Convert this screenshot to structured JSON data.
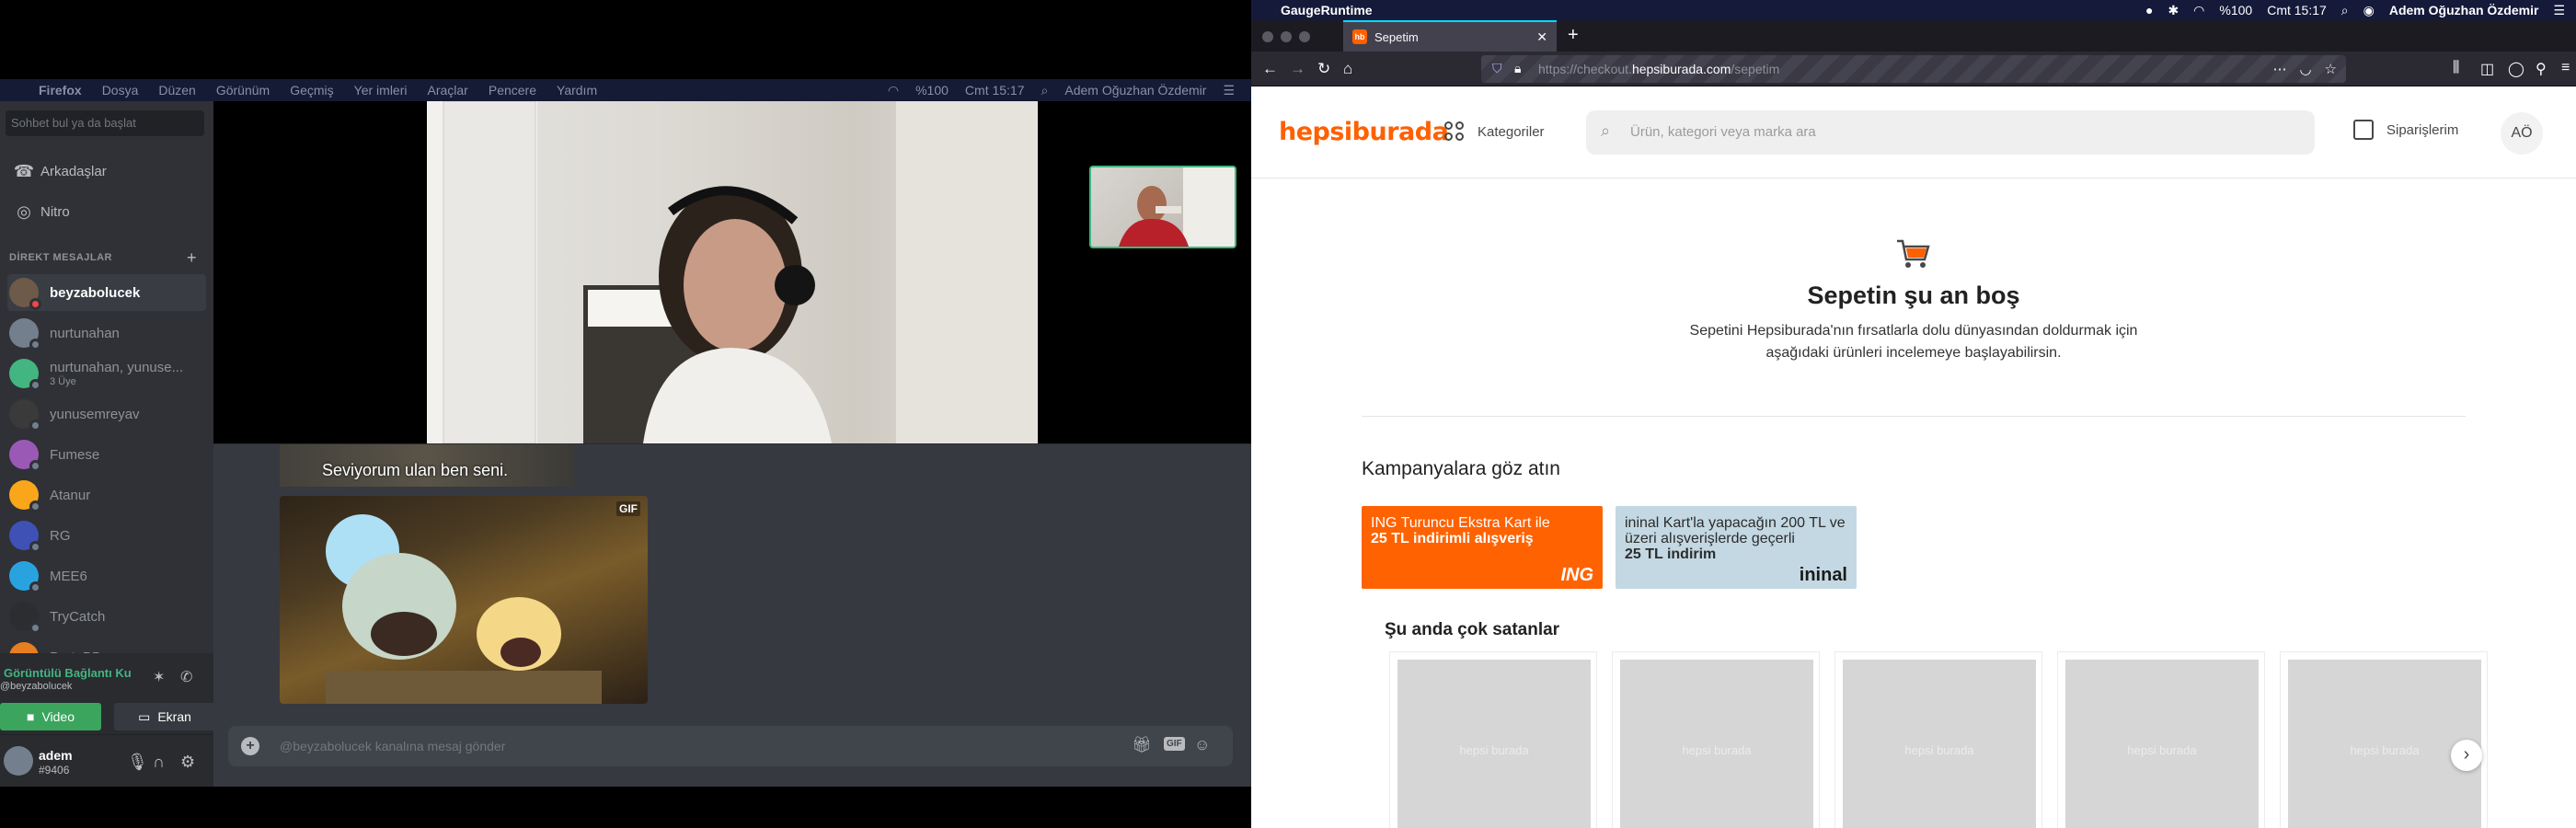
{
  "left": {
    "menubar": {
      "app": "Firefox",
      "items": [
        "Dosya",
        "Düzen",
        "Görünüm",
        "Geçmiş",
        "Yer imleri",
        "Araçlar",
        "Pencere",
        "Yardım"
      ],
      "battery": "%100",
      "clock": "Cmt 15:17",
      "user": "Adem Oğuzhan Özdemir"
    },
    "sidebar": {
      "search_placeholder": "Sohbet bul ya da başlat",
      "nav": [
        {
          "label": "Arkadaşlar",
          "icon": "friends-icon"
        },
        {
          "label": "Nitro",
          "icon": "nitro-icon"
        }
      ],
      "dm_header": "DİREKT MESAJLAR",
      "dms": [
        {
          "name": "beyzabolucek",
          "sub": "",
          "color": "#6d5a48",
          "selected": true
        },
        {
          "name": "nurtunahan",
          "sub": "",
          "color": "#747f8d",
          "selected": false
        },
        {
          "name": "nurtunahan, yunuse...",
          "sub": "3 Üye",
          "color": "#43b581",
          "selected": false
        },
        {
          "name": "yunusemreyav",
          "sub": "",
          "color": "#3a3a3a",
          "selected": false
        },
        {
          "name": "Fumese",
          "sub": "",
          "color": "#9b59b6",
          "selected": false
        },
        {
          "name": "Atanur",
          "sub": "",
          "color": "#faa61a",
          "selected": false
        },
        {
          "name": "RG",
          "sub": "",
          "color": "#3f51b5",
          "selected": false
        },
        {
          "name": "MEE6",
          "sub": "",
          "color": "#29a3e0",
          "selected": false
        },
        {
          "name": "TryCatch",
          "sub": "",
          "color": "#2b2d31",
          "selected": false
        },
        {
          "name": "PrataBB",
          "sub": "",
          "color": "#e67e22",
          "selected": false
        }
      ],
      "voice_status": "Görüntülü Bağlantı Ku",
      "voice_channel": "@beyzabolucek",
      "video_label": "Video",
      "screen_label": "Ekran",
      "user_name": "adem",
      "user_tag": "#9406"
    },
    "chat": {
      "caption": "Seviyorum ulan ben seni.",
      "gif_tag": "GIF",
      "input_placeholder": "@beyzabolucek kanalına mesaj gönder",
      "gif_button": "GIF"
    }
  },
  "right": {
    "menubar": {
      "app": "GaugeRuntime",
      "battery": "%100",
      "clock": "Cmt 15:17",
      "user": "Adem Oğuzhan Özdemir"
    },
    "tab": {
      "favicon": "hb",
      "title": "Sepetim"
    },
    "url": {
      "prefix": "https://checkout.",
      "domain": "hepsiburada.com",
      "suffix": "/sepetim"
    },
    "site": {
      "logo": "hepsiburada",
      "categories": "Kategoriler",
      "search_placeholder": "Ürün, kategori veya marka ara",
      "orders": "Siparişlerim",
      "avatar": "AÖ",
      "empty_title": "Sepetin şu an boş",
      "empty_desc": "Sepetini Hepsiburada'nın fırsatlarla dolu dünyasından doldurmak için aşağıdaki ürünleri incelemeye başlayabilirsin.",
      "campaigns_title": "Kampanyalara göz atın",
      "banners": [
        {
          "line1": "ING Turuncu Ekstra Kart ile",
          "line2": "25 TL indirimli alışveriş",
          "brand": "ING",
          "bg": "#ff6200"
        },
        {
          "line1": "ininal Kart'la yapacağın 200 TL ve üzeri alışverişlerde geçerli",
          "line2": "25 TL indirim",
          "brand": "ininal",
          "bg": "#c3d8e3"
        }
      ],
      "bestsellers_title": "Şu anda çok satanlar",
      "placeholder_text": "hepsi burada"
    }
  },
  "colors": {
    "discord_green": "#43b581",
    "hb_orange": "#ff6000",
    "firefox_tab_accent": "#00ddff"
  }
}
